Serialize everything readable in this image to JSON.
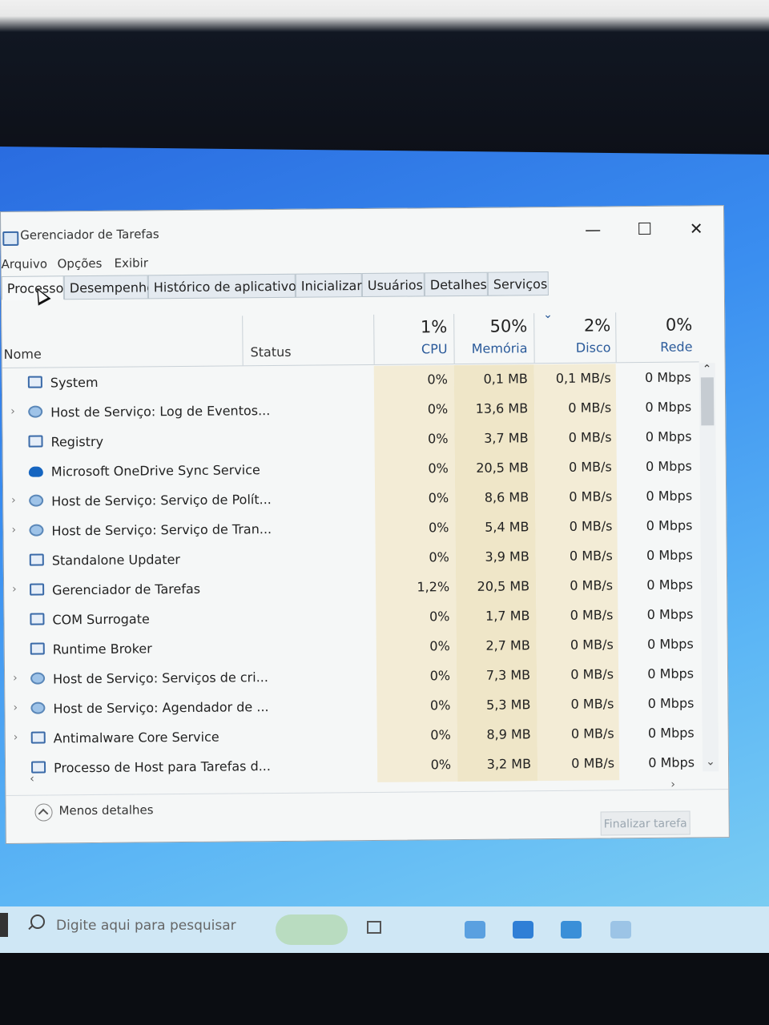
{
  "window": {
    "title": "Gerenciador de Tarefas",
    "minimize": "—",
    "close": "✕"
  },
  "menu": [
    "Arquivo",
    "Opções",
    "Exibir"
  ],
  "tabs": [
    "Processos",
    "Desempenho",
    "Histórico de aplicativos",
    "Inicializar",
    "Usuários",
    "Detalhes",
    "Serviços"
  ],
  "columns": {
    "name": "Nome",
    "status": "Status",
    "cpu_pct": "1%",
    "cpu": "CPU",
    "mem_pct": "50%",
    "mem": "Memória",
    "disk_pct": "2%",
    "disk": "Disco",
    "net_pct": "0%",
    "net": "Rede",
    "sort": "⌄"
  },
  "processes": [
    {
      "name": "System",
      "cpu": "0%",
      "mem": "0,1 MB",
      "disk": "0,1 MB/s",
      "net": "0 Mbps"
    },
    {
      "name": "Host de Serviço: Log de Eventos...",
      "cpu": "0%",
      "mem": "13,6 MB",
      "disk": "0 MB/s",
      "net": "0 Mbps"
    },
    {
      "name": "Registry",
      "cpu": "0%",
      "mem": "3,7 MB",
      "disk": "0 MB/s",
      "net": "0 Mbps"
    },
    {
      "name": "Microsoft OneDrive Sync Service",
      "cpu": "0%",
      "mem": "20,5 MB",
      "disk": "0 MB/s",
      "net": "0 Mbps"
    },
    {
      "name": "Host de Serviço: Serviço de Polít...",
      "cpu": "0%",
      "mem": "8,6 MB",
      "disk": "0 MB/s",
      "net": "0 Mbps"
    },
    {
      "name": "Host de Serviço: Serviço de Tran...",
      "cpu": "0%",
      "mem": "5,4 MB",
      "disk": "0 MB/s",
      "net": "0 Mbps"
    },
    {
      "name": "Standalone Updater",
      "cpu": "0%",
      "mem": "3,9 MB",
      "disk": "0 MB/s",
      "net": "0 Mbps"
    },
    {
      "name": "Gerenciador de Tarefas",
      "cpu": "1,2%",
      "mem": "20,5 MB",
      "disk": "0 MB/s",
      "net": "0 Mbps"
    },
    {
      "name": "COM Surrogate",
      "cpu": "0%",
      "mem": "1,7 MB",
      "disk": "0 MB/s",
      "net": "0 Mbps"
    },
    {
      "name": "Runtime Broker",
      "cpu": "0%",
      "mem": "2,7 MB",
      "disk": "0 MB/s",
      "net": "0 Mbps"
    },
    {
      "name": "Host de Serviço: Serviços de cri...",
      "cpu": "0%",
      "mem": "7,3 MB",
      "disk": "0 MB/s",
      "net": "0 Mbps"
    },
    {
      "name": "Host de Serviço: Agendador de ...",
      "cpu": "0%",
      "mem": "5,3 MB",
      "disk": "0 MB/s",
      "net": "0 Mbps"
    },
    {
      "name": "Antimalware Core Service",
      "cpu": "0%",
      "mem": "8,9 MB",
      "disk": "0 MB/s",
      "net": "0 Mbps"
    },
    {
      "name": "Processo de Host para Tarefas d...",
      "cpu": "0%",
      "mem": "3,2 MB",
      "disk": "0 MB/s",
      "net": "0 Mbps"
    }
  ],
  "footer": {
    "less_details": "Menos detalhes",
    "end_task": "Finalizar tarefa"
  },
  "taskbar": {
    "search_placeholder": "Digite aqui para pesquisar"
  }
}
